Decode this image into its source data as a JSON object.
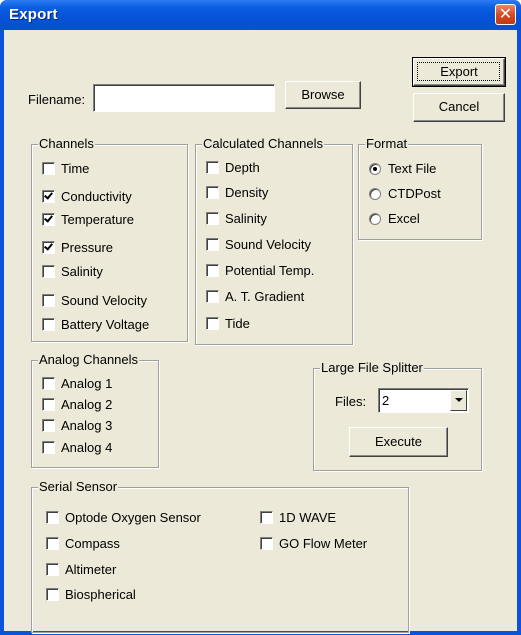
{
  "window": {
    "title": "Export",
    "close_glyph": "✕"
  },
  "top": {
    "filename_label": "Filename:",
    "filename_value": "",
    "browse_label": "Browse",
    "export_label": "Export",
    "cancel_label": "Cancel"
  },
  "channels": {
    "title": "Channels",
    "items": [
      {
        "label": "Time",
        "checked": false
      },
      {
        "label": "Conductivity",
        "checked": true
      },
      {
        "label": "Temperature",
        "checked": true
      },
      {
        "label": "Pressure",
        "checked": true
      },
      {
        "label": "Salinity",
        "checked": false
      },
      {
        "label": "Sound Velocity",
        "checked": false
      },
      {
        "label": "Battery Voltage",
        "checked": false
      }
    ]
  },
  "calculated": {
    "title": "Calculated Channels",
    "items": [
      {
        "label": "Depth",
        "checked": false
      },
      {
        "label": "Density",
        "checked": false
      },
      {
        "label": "Salinity",
        "checked": false
      },
      {
        "label": "Sound Velocity",
        "checked": false
      },
      {
        "label": "Potential Temp.",
        "checked": false
      },
      {
        "label": "A. T. Gradient",
        "checked": false
      },
      {
        "label": "Tide",
        "checked": false
      }
    ]
  },
  "format": {
    "title": "Format",
    "options": [
      {
        "label": "Text File",
        "selected": true
      },
      {
        "label": "CTDPost",
        "selected": false
      },
      {
        "label": "Excel",
        "selected": false
      }
    ]
  },
  "analog": {
    "title": "Analog Channels",
    "items": [
      {
        "label": "Analog 1",
        "checked": false
      },
      {
        "label": "Analog 2",
        "checked": false
      },
      {
        "label": "Analog 3",
        "checked": false
      },
      {
        "label": "Analog 4",
        "checked": false
      }
    ]
  },
  "splitter": {
    "title": "Large File Splitter",
    "files_label": "Files:",
    "files_value": "2",
    "execute_label": "Execute"
  },
  "serial": {
    "title": "Serial Sensor",
    "items": [
      {
        "label": "Optode Oxygen Sensor",
        "checked": false
      },
      {
        "label": "Compass",
        "checked": false
      },
      {
        "label": "Altimeter",
        "checked": false
      },
      {
        "label": "Biospherical",
        "checked": false
      },
      {
        "label": "1D WAVE",
        "checked": false
      },
      {
        "label": "GO Flow Meter",
        "checked": false
      }
    ]
  },
  "icons": {
    "close": "close-icon",
    "dropdown": "chevron-down-icon"
  }
}
